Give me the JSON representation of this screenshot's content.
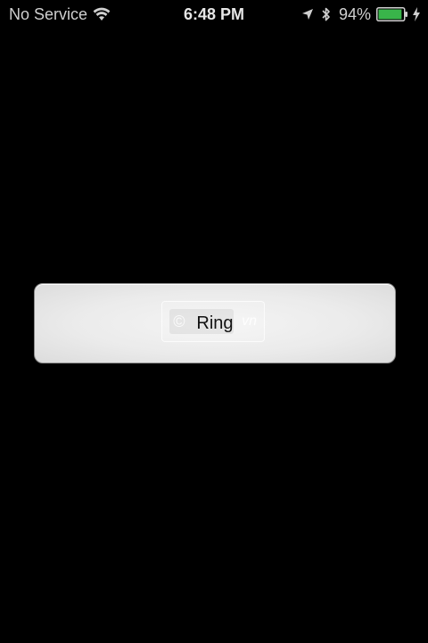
{
  "status_bar": {
    "carrier": "No Service",
    "wifi_icon": "wifi-icon",
    "time": "6:48 PM",
    "location_icon": "location-arrow-icon",
    "bluetooth_icon": "bluetooth-icon",
    "battery_percent": "94%",
    "battery_level": 0.94,
    "battery_color": "#39b54a",
    "charging_icon": "charging-bolt-icon"
  },
  "main": {
    "ring_button_label": "Ring",
    "watermark_text": "vn",
    "watermark_mark": "©"
  }
}
